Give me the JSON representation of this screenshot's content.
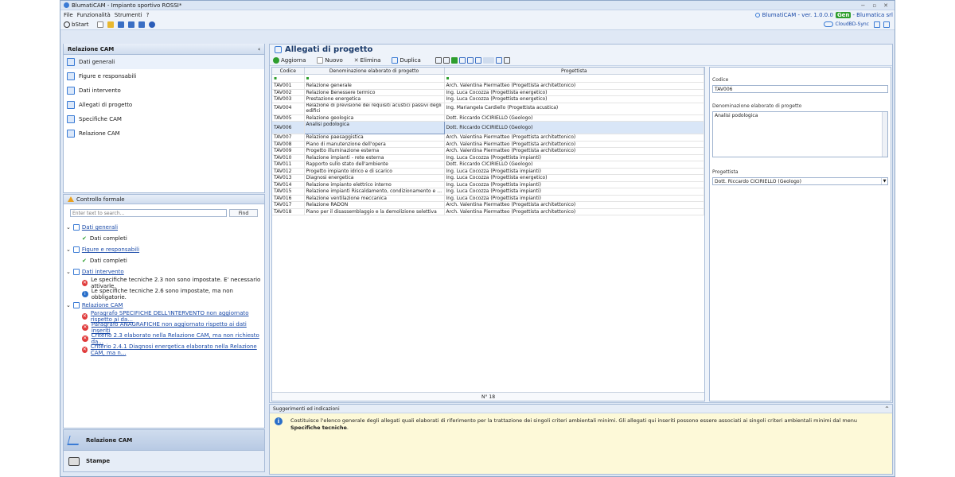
{
  "window": {
    "title": "BlumatiCAM - Impianto sportivo ROSSI*",
    "controls": [
      "−",
      "▫",
      "✕"
    ]
  },
  "menu": {
    "items": [
      "File",
      "Funzionalità",
      "Strumenti",
      "?"
    ],
    "version": "BlumatiCAM - ver. 1.0.0.0",
    "gen_logo": "Gen",
    "vendor": "- Blumatica srl"
  },
  "toolbar": {
    "bstart": "bStart",
    "cloud": "CloudBD-Sync"
  },
  "left": {
    "header": "Relazione CAM",
    "collapse": "‹",
    "nav": [
      {
        "label": "Dati generali",
        "icon": "document-icon",
        "color": "#3a7bd5"
      },
      {
        "label": "Figure e responsabili",
        "icon": "people-icon",
        "color": "#3a7bd5"
      },
      {
        "label": "Dati intervento",
        "icon": "building-icon",
        "color": "#3a7bd5"
      },
      {
        "label": "Allegati di progetto",
        "icon": "attachment-icon",
        "color": "#3a7bd5"
      },
      {
        "label": "Specifiche CAM",
        "icon": "specs-icon",
        "color": "#3a7bd5"
      },
      {
        "label": "Relazione CAM",
        "icon": "report-icon",
        "color": "#3a7bd5"
      }
    ]
  },
  "check": {
    "header": "Controllo formale",
    "search_placeholder": "Enter text to search...",
    "find": "Find",
    "groups": [
      {
        "title": "Dati generali",
        "items": [
          {
            "type": "ok",
            "text": "Dati completi"
          }
        ]
      },
      {
        "title": "Figure e responsabili",
        "items": [
          {
            "type": "ok",
            "text": "Dati completi"
          }
        ]
      },
      {
        "title": "Dati intervento",
        "items": [
          {
            "type": "err",
            "text": "Le specifiche tecniche 2.3 non sono impostate. E' necessario attivarle."
          },
          {
            "type": "info",
            "text": "Le specifiche tecniche 2.6 sono impostate, ma non obbligatorie."
          }
        ]
      },
      {
        "title": "Relazione CAM",
        "items": [
          {
            "type": "err",
            "text": "Paragrafo SPECIFICHE DELL'INTERVENTO non aggiornato rispetto ai da...",
            "link": true
          },
          {
            "type": "err",
            "text": "Paragrafo ANAGRAFICHE non aggiornato rispetto ai dati inseriti",
            "link": true
          },
          {
            "type": "err",
            "text": "Criterio 2.3 elaborato nella Relazione CAM, ma non richiesto da...",
            "link": true
          },
          {
            "type": "err",
            "text": "Criterio 2.4.1 Diagnosi energetica elaborato nella Relazione CAM, ma n...",
            "link": true
          }
        ]
      }
    ]
  },
  "bottom_nav": {
    "relazione": "Relazione CAM",
    "stampe": "Stampe"
  },
  "main": {
    "title": "Allegati di progetto",
    "toolbar": {
      "aggiorna": "Aggiorna",
      "nuovo": "Nuovo",
      "elimina": "Elimina",
      "duplica": "Duplica"
    },
    "columns": {
      "codice": "Codice",
      "denominazione": "Denominazione elaborato di progetto",
      "progettista": "Progettista"
    },
    "rows": [
      {
        "c": "TAV001",
        "d": "Relazione generale",
        "p": "Arch. Valentina Piermatteo (Progettista architettonico)"
      },
      {
        "c": "TAV002",
        "d": "Relazione Benessere termico",
        "p": "Ing. Luca Cocozza (Progettista energetico)"
      },
      {
        "c": "TAV003",
        "d": "Prestazione energetica",
        "p": "Ing. Luca Cocozza (Progettista energetico)"
      },
      {
        "c": "TAV004",
        "d": "Relazione di previsione dei requisiti acustici passivi degli edifici",
        "p": "Ing. Mariangela Cardiello (Progettista acustica)",
        "tall": true
      },
      {
        "c": "TAV005",
        "d": "Relazione geologica",
        "p": "Dott. Riccardo CICIRIELLO (Geologo)"
      },
      {
        "c": "TAV006",
        "d": "Analisi podologica",
        "p": "Dott. Riccardo CICIRIELLO (Geologo)",
        "sel": true
      },
      {
        "c": "TAV007",
        "d": "Relazione paesaggistica",
        "p": "Arch. Valentina Piermatteo (Progettista architettonico)"
      },
      {
        "c": "TAV008",
        "d": "Piano di manutenzione dell'opera",
        "p": "Arch. Valentina Piermatteo (Progettista architettonico)"
      },
      {
        "c": "TAV009",
        "d": "Progetto illuminazione esterna",
        "p": "Arch. Valentina Piermatteo (Progettista architettonico)"
      },
      {
        "c": "TAV010",
        "d": "Relazione impianti - rete esterna",
        "p": "Ing. Luca Cocozza (Progettista impianti)"
      },
      {
        "c": "TAV011",
        "d": "Rapporto sullo stato dell'ambiente",
        "p": "Dott. Riccardo CICIRIELLO (Geologo)"
      },
      {
        "c": "TAV012",
        "d": "Progetto impianto idrico e di scarico",
        "p": "Ing. Luca Cocozza (Progettista impianti)"
      },
      {
        "c": "TAV013",
        "d": "Diagnosi energetica",
        "p": "Ing. Luca Cocozza (Progettista energetico)"
      },
      {
        "c": "TAV014",
        "d": "Relazione impianto elettrico interno",
        "p": "Ing. Luca Cocozza (Progettista impianti)"
      },
      {
        "c": "TAV015",
        "d": "Relazione impianti Riscaldamento, condizionamento e ACS",
        "p": "Ing. Luca Cocozza (Progettista impianti)"
      },
      {
        "c": "TAV016",
        "d": "Relazione ventilazione meccanica",
        "p": "Ing. Luca Cocozza (Progettista impianti)"
      },
      {
        "c": "TAV017",
        "d": "Relazione RADON",
        "p": "Arch. Valentina Piermatteo (Progettista architettonico)"
      },
      {
        "c": "TAV018",
        "d": "Piano per il disassemblaggio e la demolizione selettiva",
        "p": "Arch. Valentina Piermatteo (Progettista architettonico)"
      }
    ],
    "count": "N° 18"
  },
  "detail": {
    "codice_label": "Codice",
    "codice_value": "TAV006",
    "den_label": "Denominazione elaborato di progetto",
    "den_value": "Analisi podologica",
    "prog_label": "Progettista",
    "prog_value": "Dott. Riccardo CICIRIELLO (Geologo)"
  },
  "hints": {
    "header": "Suggerimenti ed indicazioni",
    "text_before": "Costituisce l'elenco generale degli allegati quali elaborati di riferimento per la trattazione dei singoli criteri ambientali minimi. Gli allegati qui inseriti possono essere associati ai singoli criteri ambientali minimi dal menu ",
    "text_bold": "Specifiche tecniche",
    "text_after": "."
  }
}
